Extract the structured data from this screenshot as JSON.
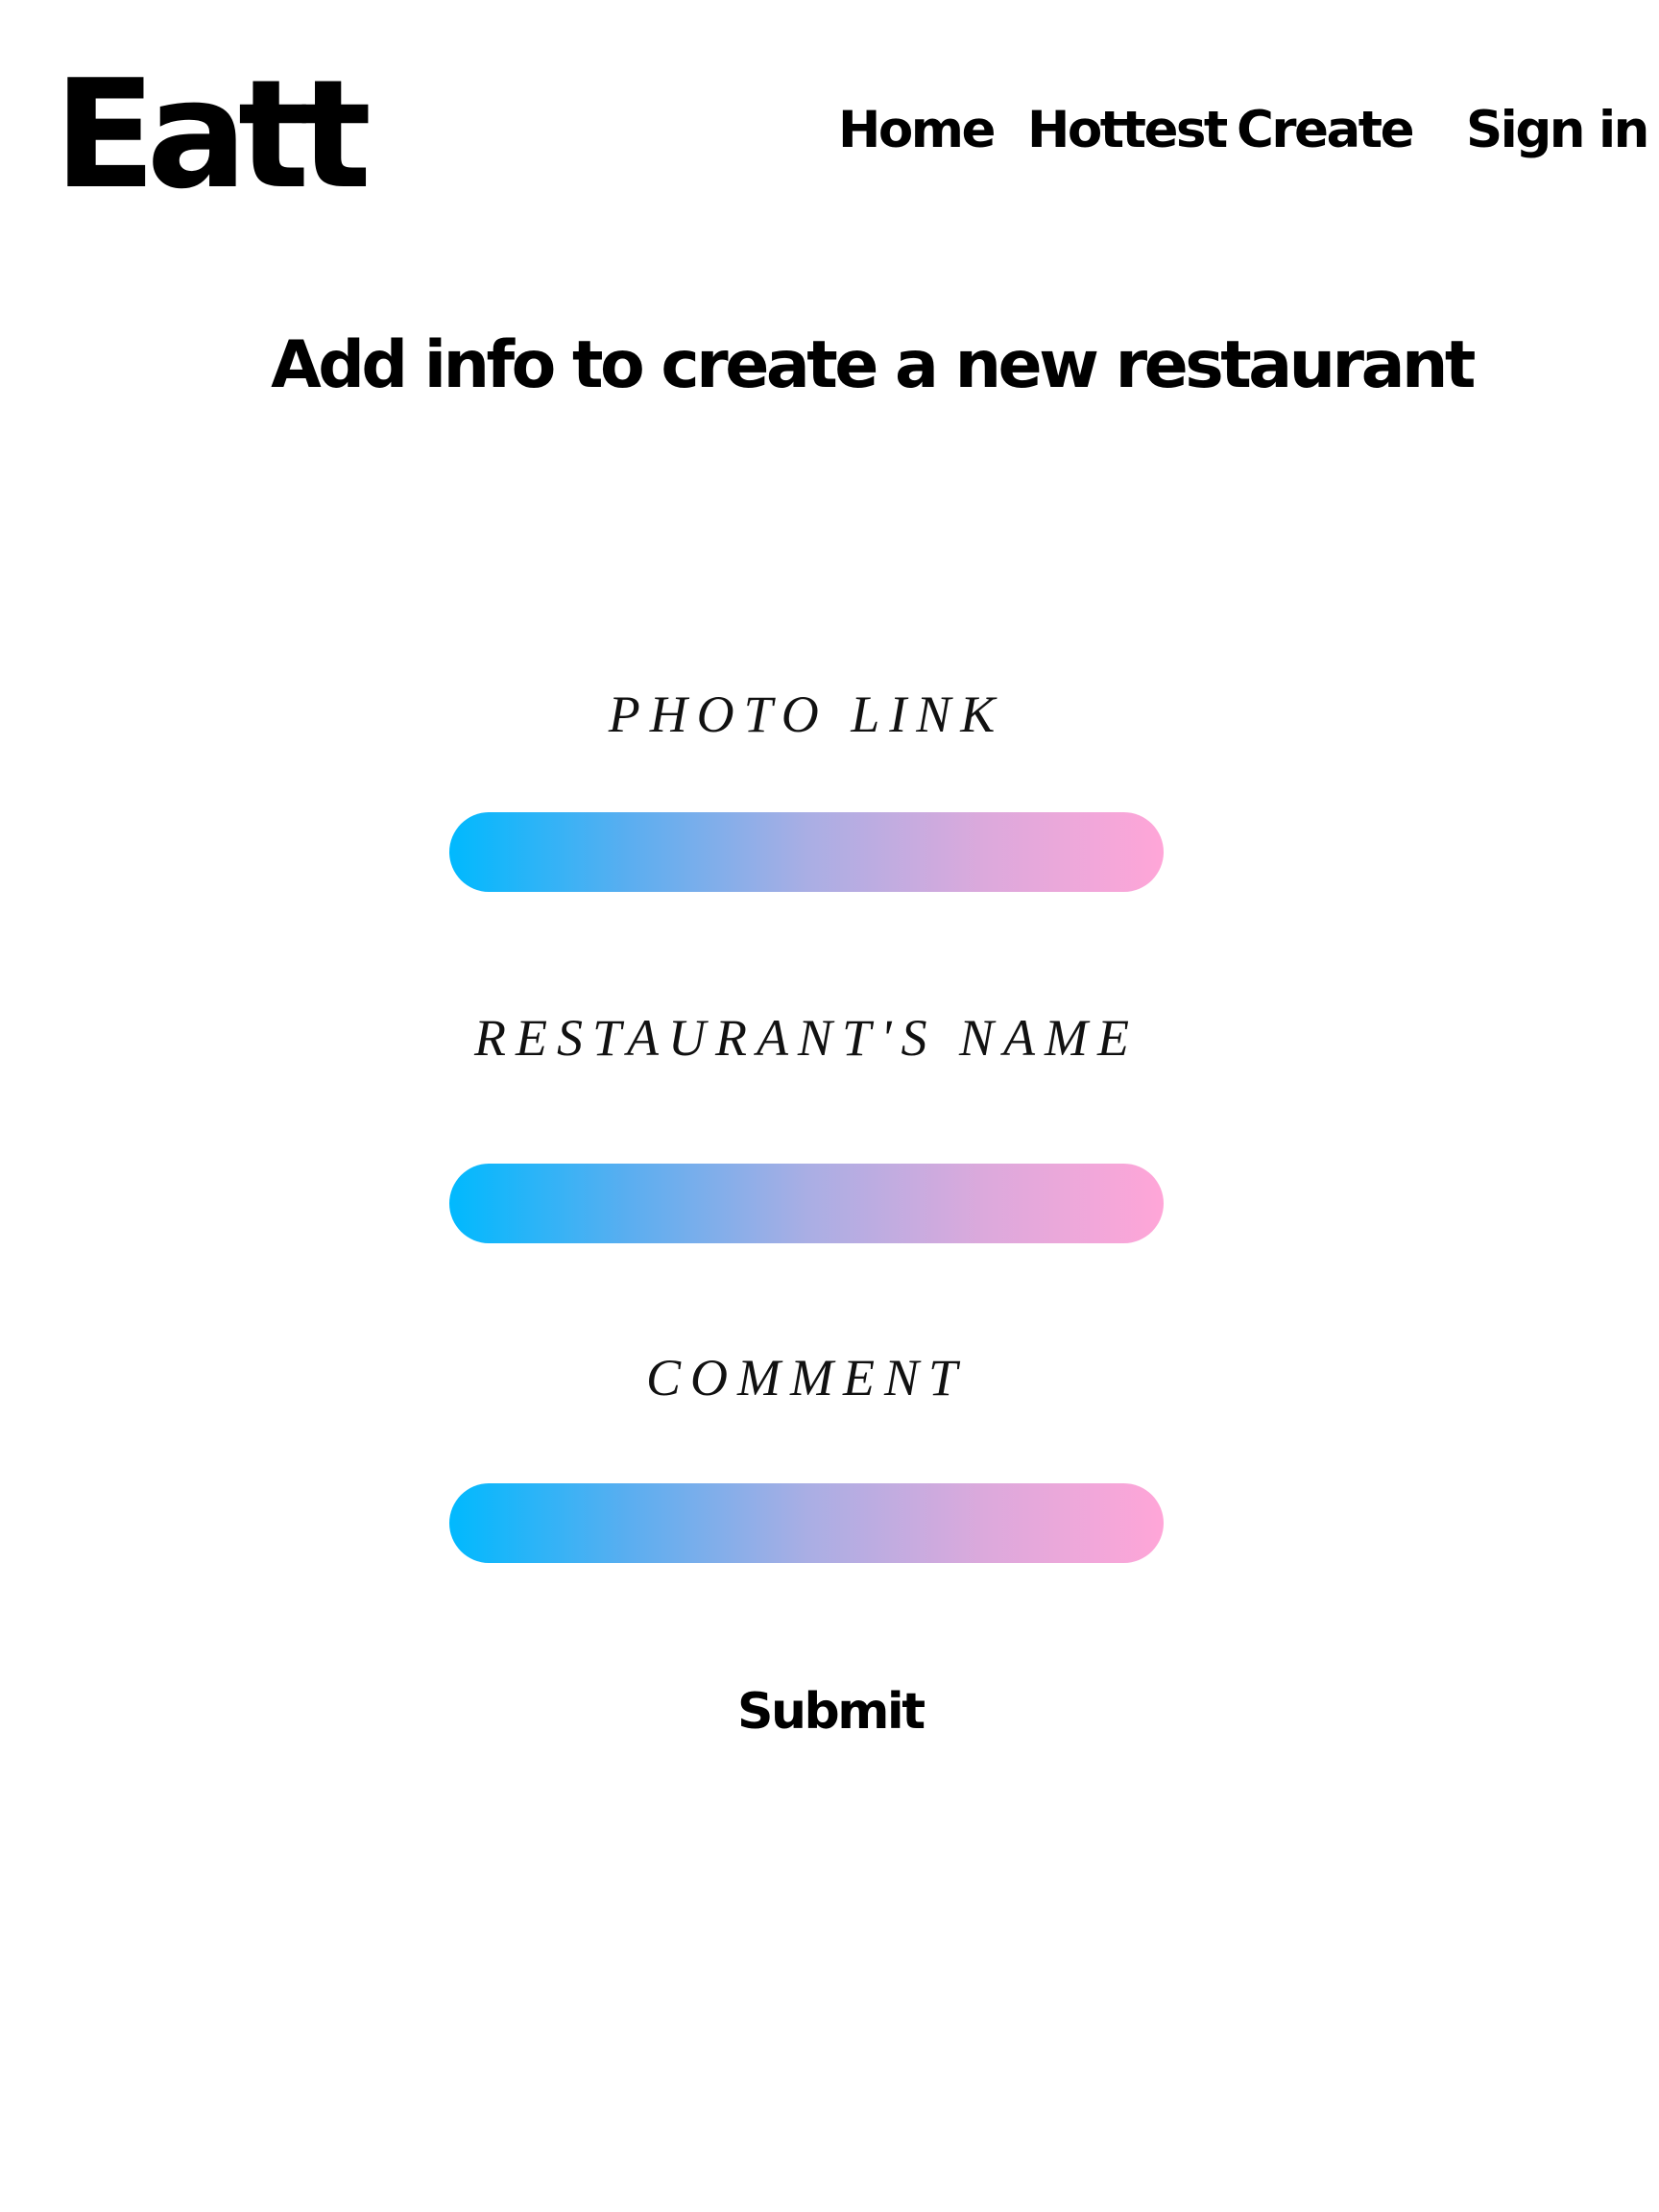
{
  "header": {
    "logo": "Eatt",
    "nav": {
      "home": "Home",
      "hottest": "Hottest",
      "create": "Create",
      "signin": "Sign in"
    }
  },
  "main": {
    "title": "Add info to create a new restaurant",
    "fields": {
      "photo_link": {
        "label": "PHOTO LINK",
        "value": ""
      },
      "restaurant_name": {
        "label": "RESTAURANT'S NAME",
        "value": ""
      },
      "comment": {
        "label": "COMMENT",
        "value": ""
      }
    },
    "submit_label": "Submit"
  },
  "colors": {
    "input_gradient_start": "#00b9fe",
    "input_gradient_end": "#ffa6d8",
    "text": "#000000",
    "background": "#ffffff"
  }
}
